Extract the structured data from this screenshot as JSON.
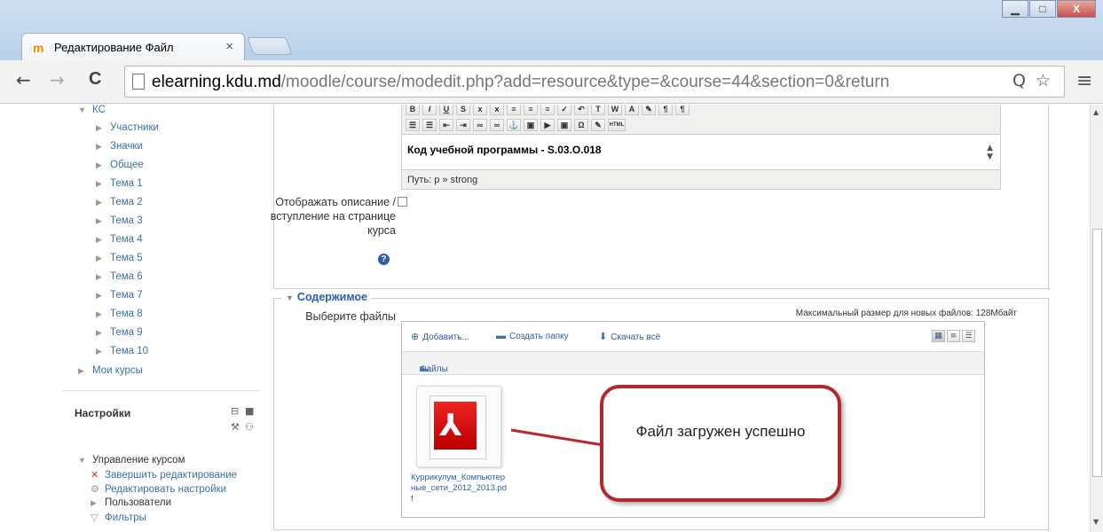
{
  "window": {
    "tab_title": "Редактирование Файл",
    "tab_close": "×",
    "controls": {
      "minimize": "▁",
      "maximize": "□",
      "close": "X"
    }
  },
  "toolbar": {
    "back": "←",
    "forward": "→",
    "reload": "C",
    "url_host": "elearning.kdu.md",
    "url_path": "/moodle/course/modedit.php?add=resource&type=&course=44&section=0&return",
    "zoom_icon": "Q",
    "star_icon": "☆",
    "menu_icon": "≡"
  },
  "sidebar": {
    "course_label": "КС",
    "course_items": [
      "Участники",
      "Значки",
      "Общее",
      "Тема 1",
      "Тема 2",
      "Тема 3",
      "Тема 4",
      "Тема 5",
      "Тема 6",
      "Тема 7",
      "Тема 8",
      "Тема 9",
      "Тема 10"
    ],
    "my_courses": "Мои курсы",
    "settings_title": "Настройки",
    "manage_label": "Управление курсом",
    "manage_items": [
      "Завершить редактирование",
      "Редактировать настройки",
      "Пользователи",
      "Фильтры"
    ]
  },
  "editor": {
    "content_text": "Код учебной программы   - S.03.O.018",
    "path_text": "Путь: p » strong"
  },
  "description_option": {
    "label": "Отображать описание / вступление на странице курса",
    "checked": false
  },
  "content_section": {
    "legend": "Содержимое",
    "select_files_label": "Выберите файлы",
    "max_size_text": "Максимальный размер для новых файлов: 128Мбайт",
    "actions": {
      "add": "Добавить...",
      "create_folder": "Создать папку",
      "download_all": "Скачать всё"
    },
    "path_label": "Файлы",
    "file_name": "Куррикулум_Компьютерные_сети_2012_2013.pdf"
  },
  "callout": {
    "text": "Файл загружен успешно"
  },
  "colors": {
    "link": "#2b5fa8",
    "callout_border": "#b3282d",
    "pdf_red": "#d01010"
  }
}
